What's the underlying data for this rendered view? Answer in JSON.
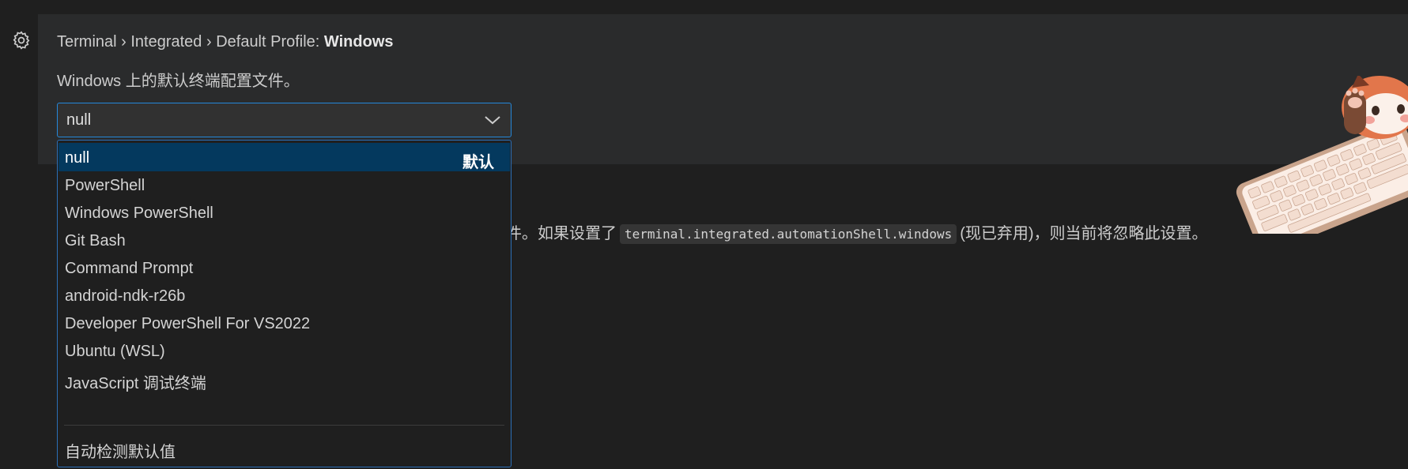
{
  "setting": {
    "category": "Terminal › Integrated › Default Profile: ",
    "key": "Windows",
    "description": "Windows 上的默认终端配置文件。",
    "selected_value": "null",
    "options": [
      {
        "label": "null",
        "tag": "默认",
        "selected": true
      },
      {
        "label": "PowerShell"
      },
      {
        "label": "Windows PowerShell"
      },
      {
        "label": "Git Bash"
      },
      {
        "label": "Command Prompt"
      },
      {
        "label": "android-ndk-r26b"
      },
      {
        "label": "Developer PowerShell For VS2022"
      },
      {
        "label": "Ubuntu (WSL)"
      },
      {
        "label": "JavaScript 调试终端"
      },
      {
        "label": "自动检测默认值"
      }
    ]
  },
  "next_setting": {
    "desc_before": "件。如果设置了",
    "code": "terminal.integrated.automationShell.windows",
    "desc_after": "(现已弃用)，则当前将忽略此设置。"
  },
  "icons": {
    "settings": "gear-icon",
    "dropdown": "chevron-down-icon",
    "mascot": "red-panda-keyboard-image"
  },
  "colors": {
    "focus_border": "#2488db",
    "selected_row": "#04395e",
    "background": "#1f1f1f",
    "card": "#2a2b2c"
  }
}
